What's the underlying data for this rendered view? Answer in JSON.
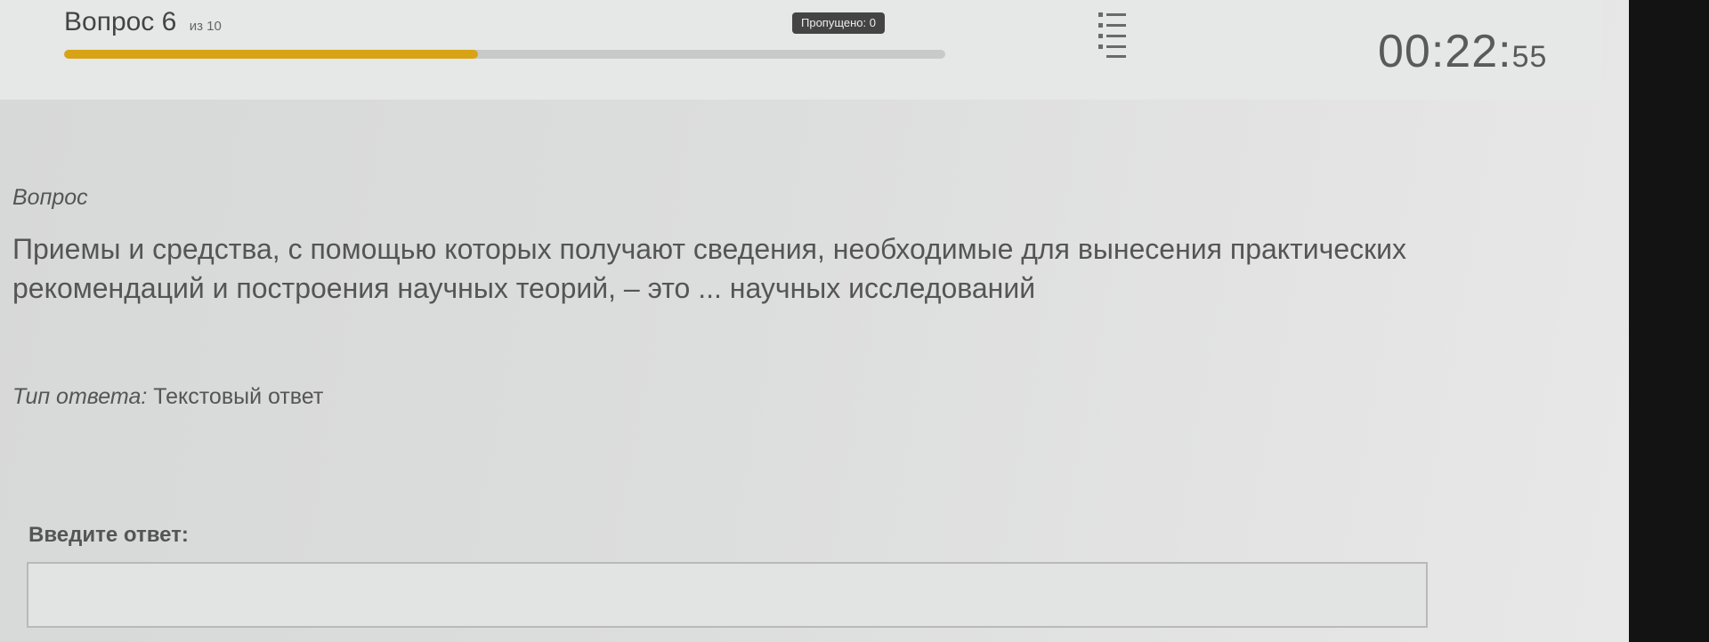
{
  "header": {
    "question_word": "Вопрос",
    "question_number": "6",
    "question_of": "из 10",
    "progress_fraction": 0.47,
    "skipped_label": "Пропущено: 0",
    "list_icon": "list-icon",
    "timer_main": "00:22:",
    "timer_seconds": "55"
  },
  "question": {
    "label": "Вопрос",
    "text": "Приемы и средства, с помощью которых получают сведения, необходимые для вынесения практических рекомендаций и построения научных теорий, – это ... научных исследований"
  },
  "answer_type": {
    "label": "Тип ответа:",
    "value": "Текстовый ответ"
  },
  "answer_input": {
    "label": "Введите ответ:",
    "value": "",
    "placeholder": ""
  },
  "colors": {
    "progress": "#d8a416",
    "header_bg": "#e6e7e7",
    "badge_bg": "#444444"
  }
}
